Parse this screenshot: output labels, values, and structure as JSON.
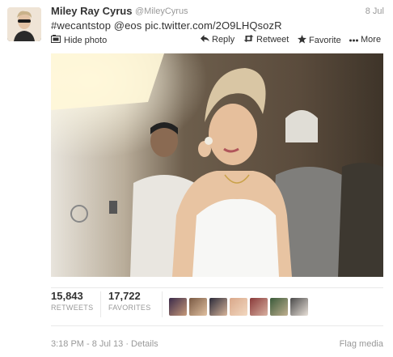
{
  "tweet": {
    "fullname": "Miley Ray Cyrus",
    "username": "@MileyCyrus",
    "date": "8 Jul",
    "text": "#wecantstop @eos pic.twitter.com/2O9LHQsozR"
  },
  "actions": {
    "hide_photo": "Hide photo",
    "reply": "Reply",
    "retweet": "Retweet",
    "favorite": "Favorite",
    "more": "More"
  },
  "stats": {
    "retweets_count": "15,843",
    "retweets_label": "RETWEETS",
    "favorites_count": "17,722",
    "favorites_label": "FAVORITES"
  },
  "footer": {
    "timestamp": "3:18 PM - 8 Jul 13 · Details",
    "flag": "Flag media"
  },
  "icons": {
    "hide_photo": "photo-icon",
    "reply": "reply-arrow-icon",
    "retweet": "retweet-icon",
    "favorite": "star-icon",
    "more": "ellipsis-icon"
  },
  "colors": {
    "text": "#333333",
    "muted": "#999999",
    "divider": "#e8e8e8"
  }
}
